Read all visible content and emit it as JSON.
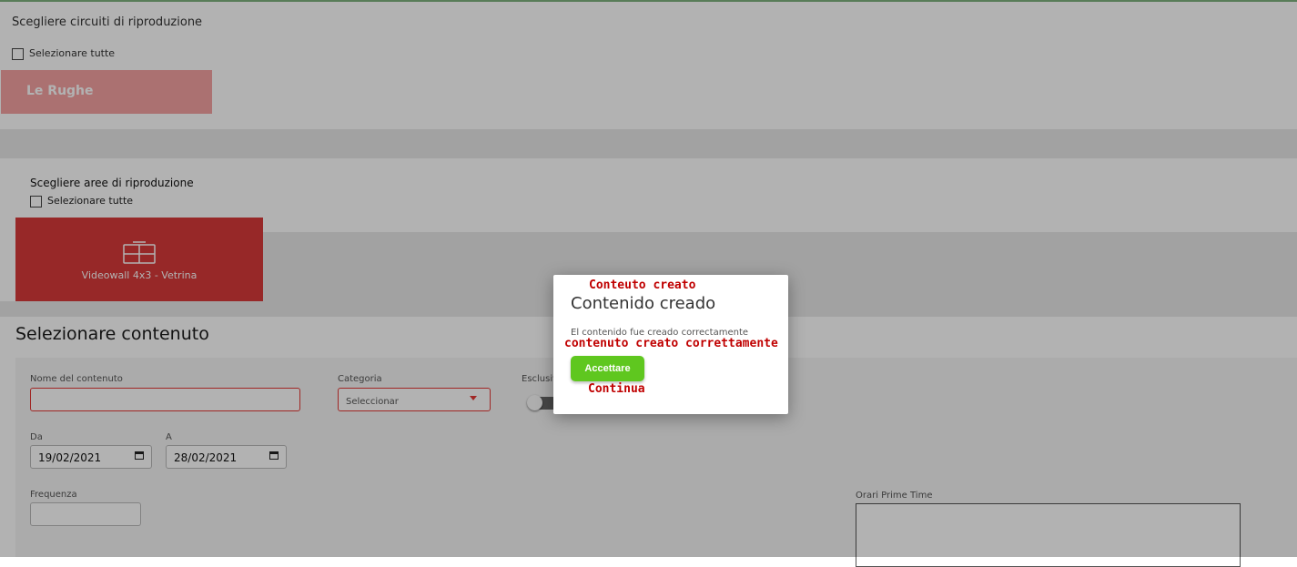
{
  "circuits": {
    "heading": "Scegliere circuiti di riproduzione",
    "select_all": "Selezionare tutte",
    "items": [
      "Le Rughe"
    ]
  },
  "areas": {
    "heading": "Scegliere aree di riproduzione",
    "select_all": "Selezionare tutte",
    "items": [
      {
        "label": "Videowall 4x3 - Vetrina",
        "icon": "videowall-icon"
      }
    ]
  },
  "content": {
    "heading": "Selezionare contenuto",
    "fields": {
      "name_label": "Nome del contenuto",
      "name_value": "",
      "category_label": "Categoria",
      "category_value": "Seleccionar",
      "exclusive_label": "Esclusiv",
      "from_label": "Da",
      "from_value": "19/02/2021",
      "to_label": "A",
      "to_value": "28/02/2021",
      "frequency_label": "Frequenza",
      "frequency_value": "",
      "prime_time_label": "Orari Prime Time"
    }
  },
  "dialog": {
    "title": "Contenido creado",
    "message": "El contenido fue creado correctamente",
    "button_label": "Accettare",
    "annotations": {
      "title": "Conteuto creato",
      "message": "contenuto creato correttamente",
      "button": "Continua"
    }
  },
  "colors": {
    "accent_red": "#d93a3a",
    "accept_green": "#5fc71f",
    "annotation_red": "#c00000"
  }
}
